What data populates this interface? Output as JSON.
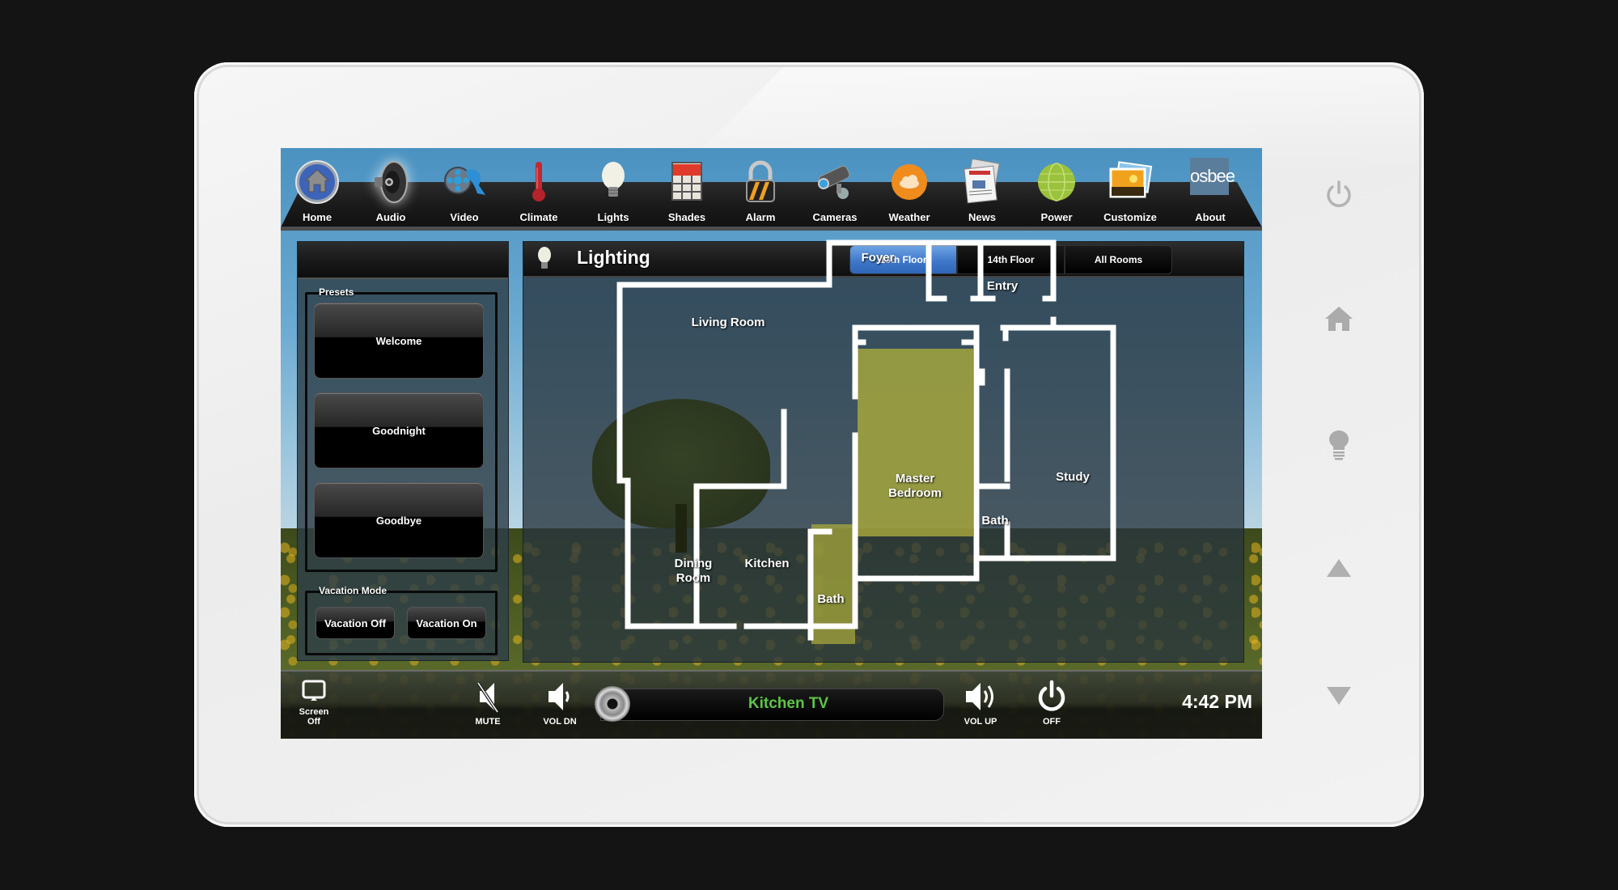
{
  "nav": {
    "items": [
      {
        "label": "Home",
        "icon": "home-icon"
      },
      {
        "label": "Audio",
        "icon": "speaker-icon",
        "active": true
      },
      {
        "label": "Video",
        "icon": "film-reel-icon"
      },
      {
        "label": "Climate",
        "icon": "thermometer-icon"
      },
      {
        "label": "Lights",
        "icon": "lightbulb-icon"
      },
      {
        "label": "Shades",
        "icon": "window-shade-icon"
      },
      {
        "label": "Alarm",
        "icon": "padlock-icon"
      },
      {
        "label": "Cameras",
        "icon": "security-camera-icon"
      },
      {
        "label": "Weather",
        "icon": "sun-cloud-icon"
      },
      {
        "label": "News",
        "icon": "newspaper-icon"
      },
      {
        "label": "Power",
        "icon": "globe-icon"
      },
      {
        "label": "Customize",
        "icon": "photo-icon"
      },
      {
        "label": "About",
        "icon": "osbee-logo",
        "logo_text": "osbee"
      }
    ]
  },
  "left_panel": {
    "presets": {
      "title": "Presets",
      "buttons": [
        "Welcome",
        "Goodnight",
        "Goodbye"
      ]
    },
    "vacation": {
      "title": "Vacation Mode",
      "buttons": [
        "Vacation Off",
        "Vacation On"
      ]
    }
  },
  "lighting": {
    "title": "Lighting",
    "icon": "lightbulb-icon",
    "tabs": [
      {
        "label": "13th Floor",
        "active": true
      },
      {
        "label": "14th Floor",
        "active": false
      },
      {
        "label": "All Rooms",
        "active": false
      }
    ],
    "rooms": [
      {
        "name": "Foyer",
        "lit": false
      },
      {
        "name": "Entry",
        "lit": false
      },
      {
        "name": "Living Room",
        "lit": false
      },
      {
        "name": "Dining Room",
        "lit": false
      },
      {
        "name": "Kitchen",
        "lit": false
      },
      {
        "name": "Bath",
        "lit": true
      },
      {
        "name": "Master Bedroom",
        "lit": true
      },
      {
        "name": "Bath",
        "lit": false
      },
      {
        "name": "Study",
        "lit": false
      }
    ],
    "room_labels": {
      "foyer": "Foyer",
      "entry": "Entry",
      "living": "Living Room",
      "dining_1": "Dining",
      "dining_2": "Room",
      "kitchen": "Kitchen",
      "bath_small": "Bath",
      "master_1": "Master",
      "master_2": "Bedroom",
      "bath_right": "Bath",
      "study": "Study"
    },
    "lit_color": "#a7a83c"
  },
  "bottom_bar": {
    "screen_off": {
      "line1": "Screen",
      "line2": "Off"
    },
    "mute": "MUTE",
    "vol_dn": "VOL DN",
    "source": "Kitchen TV",
    "vol_up": "VOL UP",
    "off": "OFF",
    "time": "4:42 PM",
    "source_color": "#5ec545"
  },
  "hardware_buttons": [
    "power-icon",
    "home-icon",
    "lightbulb-icon",
    "arrow-up-icon",
    "arrow-down-icon"
  ]
}
